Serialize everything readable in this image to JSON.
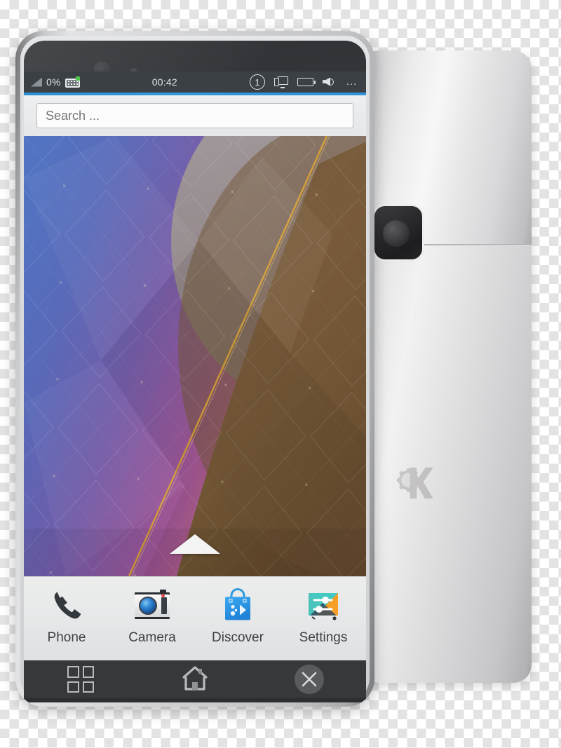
{
  "scene": {
    "description": "KDE Plasma Mobile smartphone mockup, front and back views",
    "background": "transparency-checkerboard"
  },
  "front_phone": {
    "frame_color": "#d0d1d2",
    "statusbar": {
      "background": "#3b4045",
      "battery_percent": "0%",
      "signal_icon": "signal-strength-icon",
      "keyboard_icon": "keyboard-icon",
      "clock": "00:42",
      "notification_count": "1",
      "notification_icon": "notification-circle-icon",
      "device_icon": "kdeconnect-device-icon",
      "battery_icon": "battery-icon",
      "volume_icon": "volume-speaker-icon",
      "overflow_icon": "overflow-dots-icon",
      "accent_color": "#3498db"
    },
    "search": {
      "placeholder": "Search ...",
      "value": ""
    },
    "wallpaper": {
      "name": "plasma-geometric-wallpaper",
      "colors": [
        "#3f6fc4",
        "#6a4f9e",
        "#b martin",
        "#8a4e8f",
        "#c4628f",
        "#7a5230",
        "#6b4a26"
      ],
      "drawer_handle_icon": "drawer-up-arrow-icon"
    },
    "dock": {
      "background": "#e6e7e8",
      "apps": [
        {
          "label": "Phone",
          "icon": "phone-handset-icon"
        },
        {
          "label": "Camera",
          "icon": "camera-icon"
        },
        {
          "label": "Discover",
          "icon": "discover-shopping-bag-icon"
        },
        {
          "label": "Settings",
          "icon": "settings-sliders-icon"
        }
      ]
    },
    "navbar": {
      "background": "#36393c",
      "buttons": [
        {
          "name": "task-switcher",
          "icon": "grid-squares-icon"
        },
        {
          "name": "home",
          "icon": "home-house-icon"
        },
        {
          "name": "close",
          "icon": "close-x-icon"
        }
      ]
    }
  },
  "back_phone": {
    "body_color": "#dcdcde",
    "camera_icon": "rear-camera-icon",
    "logo_icon": "kde-gear-k-logo"
  }
}
